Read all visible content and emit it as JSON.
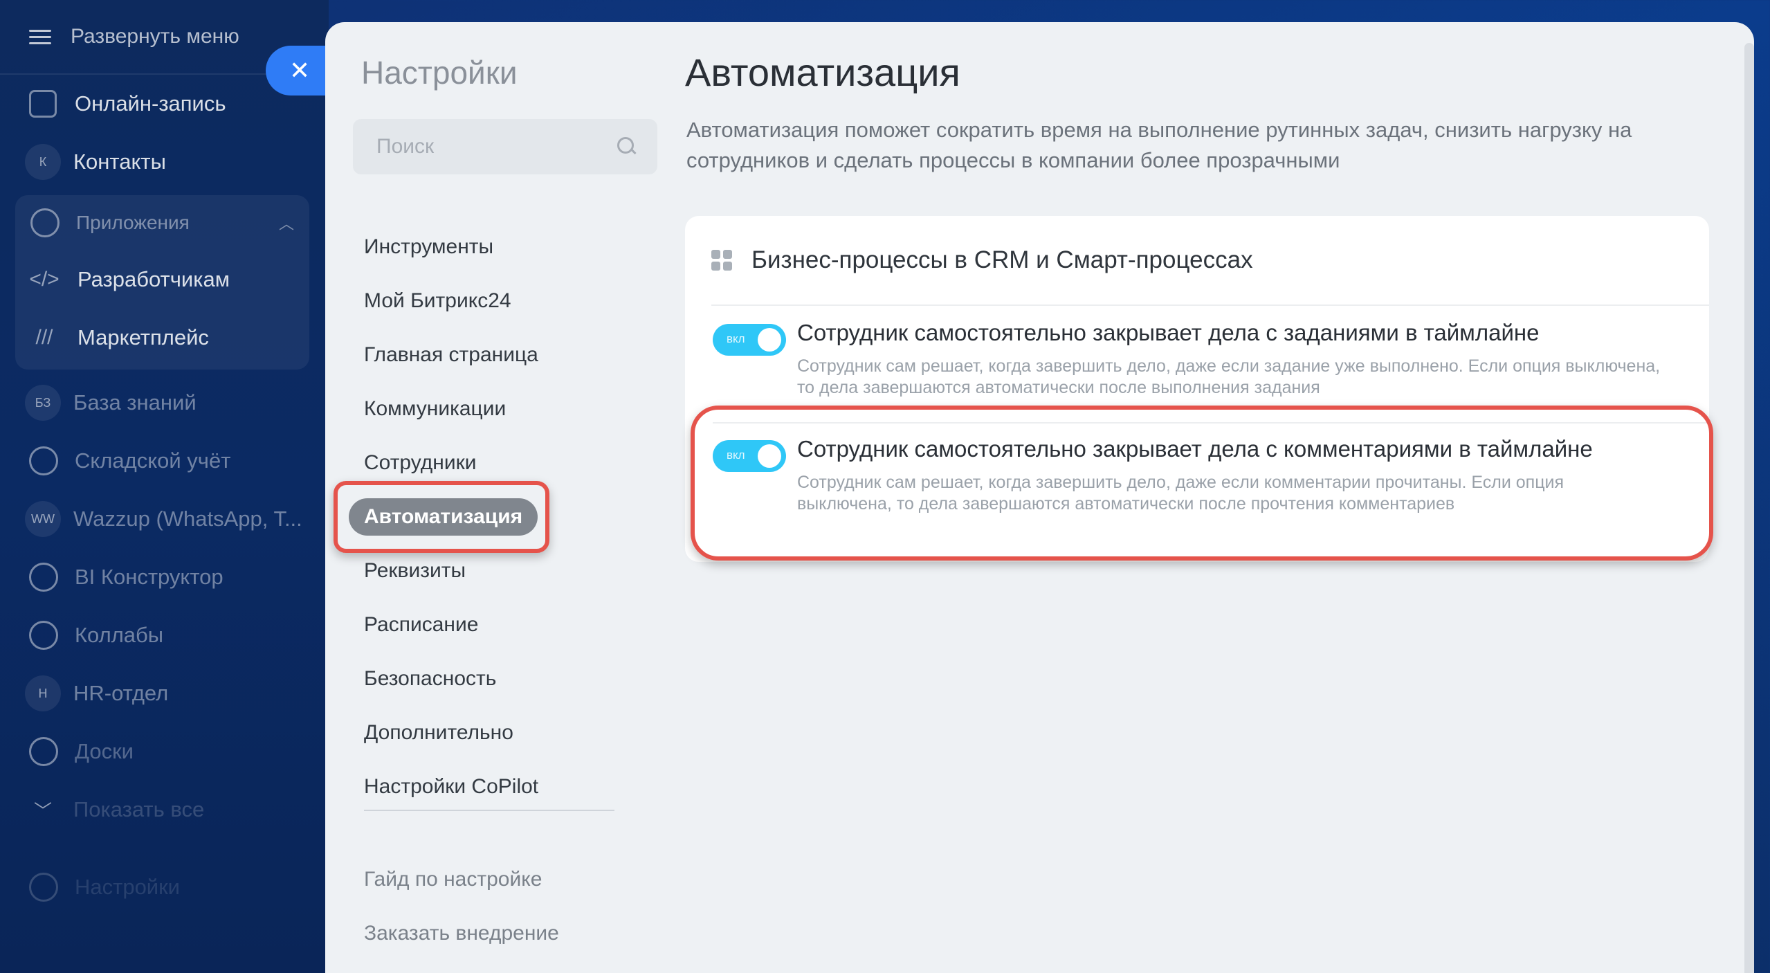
{
  "sidebar": {
    "expand_label": "Развернуть меню",
    "items_top": [
      {
        "label": "Онлайн-запись",
        "icon": "calendar-icon"
      },
      {
        "label": "Контакты",
        "badge": "К"
      }
    ],
    "apps": {
      "label": "Приложения",
      "items": [
        {
          "label": "Разработчикам",
          "icon": "code-icon"
        },
        {
          "label": "Маркетплейс",
          "icon": "market-icon"
        }
      ]
    },
    "items_bottom": [
      {
        "label": "База знаний",
        "badge": "БЗ"
      },
      {
        "label": "Складской учёт",
        "icon": "warehouse-icon"
      },
      {
        "label": "Wazzup (WhatsApp, T...",
        "badge": "WW"
      },
      {
        "label": "BI Конструктор",
        "icon": "chart-icon"
      },
      {
        "label": "Коллабы",
        "icon": "hexagon-icon"
      },
      {
        "label": "HR-отдел",
        "badge": "H"
      },
      {
        "label": "Доски",
        "icon": "board-icon"
      },
      {
        "label": "Показать все",
        "icon": "chevron-down-icon"
      },
      {
        "label": "Настройки",
        "icon": "gear-icon"
      }
    ]
  },
  "close_glyph": "✕",
  "settings": {
    "title": "Настройки",
    "search_placeholder": "Поиск",
    "nav": [
      "Инструменты",
      "Мой Битрикс24",
      "Главная страница",
      "Коммуникации",
      "Сотрудники",
      "Автоматизация",
      "Реквизиты",
      "Расписание",
      "Безопасность",
      "Дополнительно",
      "Настройки CoPilot"
    ],
    "active_index": 5,
    "nav_secondary": [
      "Гайд по настройке",
      "Заказать внедрение"
    ]
  },
  "main": {
    "title": "Автоматизация",
    "description": "Автоматизация поможет сократить время на выполнение рутинных задач, снизить нагрузку на сотрудников и сделать процессы в компании более прозрачными",
    "card": {
      "title": "Бизнес-процессы в CRM и Смарт-процессах",
      "rows": [
        {
          "toggle_label": "вкл",
          "enabled": true,
          "title": "Сотрудник самостоятельно закрывает дела с заданиями в таймлайне",
          "description": "Сотрудник сам решает, когда завершить дело, даже если задание уже выполнено. Если опция выключена, то дела завершаются автоматически после выполнения задания"
        },
        {
          "toggle_label": "вкл",
          "enabled": true,
          "title": "Сотрудник самостоятельно закрывает дела с комментариями в таймлайне",
          "description": "Сотрудник сам решает, когда завершить дело, даже если комментарии прочитаны. Если опция выключена, то дела завершаются автоматически после прочтения комментариев"
        }
      ]
    }
  },
  "colors": {
    "accent": "#2f7cf6",
    "toggle_on": "#2fc7f7",
    "highlight": "#e5534b"
  }
}
